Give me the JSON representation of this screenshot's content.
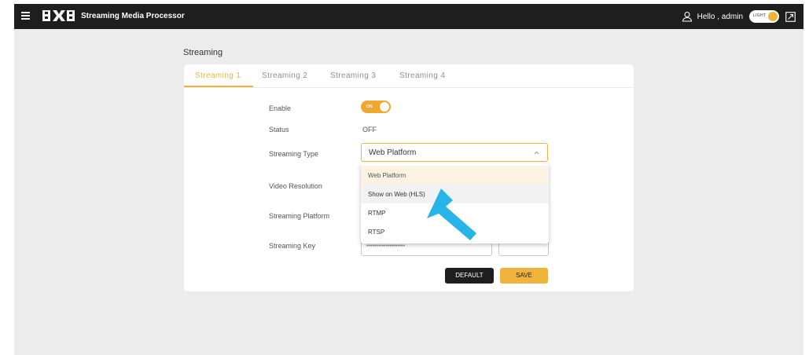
{
  "header": {
    "logo_text": "BXB",
    "title": "Streaming Media Processor",
    "greeting": "Hello , admin",
    "theme_label": "LIGHT",
    "icons": [
      "menu-icon",
      "user-icon",
      "expand-icon"
    ]
  },
  "page": {
    "section_title": "Streaming"
  },
  "tabs": [
    {
      "label": "Streaming 1",
      "active": true
    },
    {
      "label": "Streaming 2",
      "active": false
    },
    {
      "label": "Streaming 3",
      "active": false
    },
    {
      "label": "Streaming 4",
      "active": false
    }
  ],
  "form": {
    "enable_label": "Enable",
    "enable_switch_text": "ON",
    "enable_on": true,
    "status_label": "Status",
    "status_value": "OFF",
    "streaming_type_label": "Streaming Type",
    "streaming_type_value": "Web Platform",
    "video_resolution_label": "Video Resolution",
    "streaming_platform_label": "Streaming Platform",
    "streaming_key_label": "Streaming Key",
    "streaming_key_value": "••••••••••••••••••••"
  },
  "dropdown": {
    "options": [
      "Web Platform",
      "Show on Web (HLS)",
      "RTMP",
      "RTSP"
    ],
    "selected": "Web Platform",
    "hovered": "Show on Web (HLS)"
  },
  "buttons": {
    "default_label": "DEFAULT",
    "save_label": "SAVE"
  },
  "colors": {
    "accent": "#f0b43c",
    "topbar": "#1e1e1e",
    "background": "#ececec",
    "arrow": "#27b4e6"
  }
}
